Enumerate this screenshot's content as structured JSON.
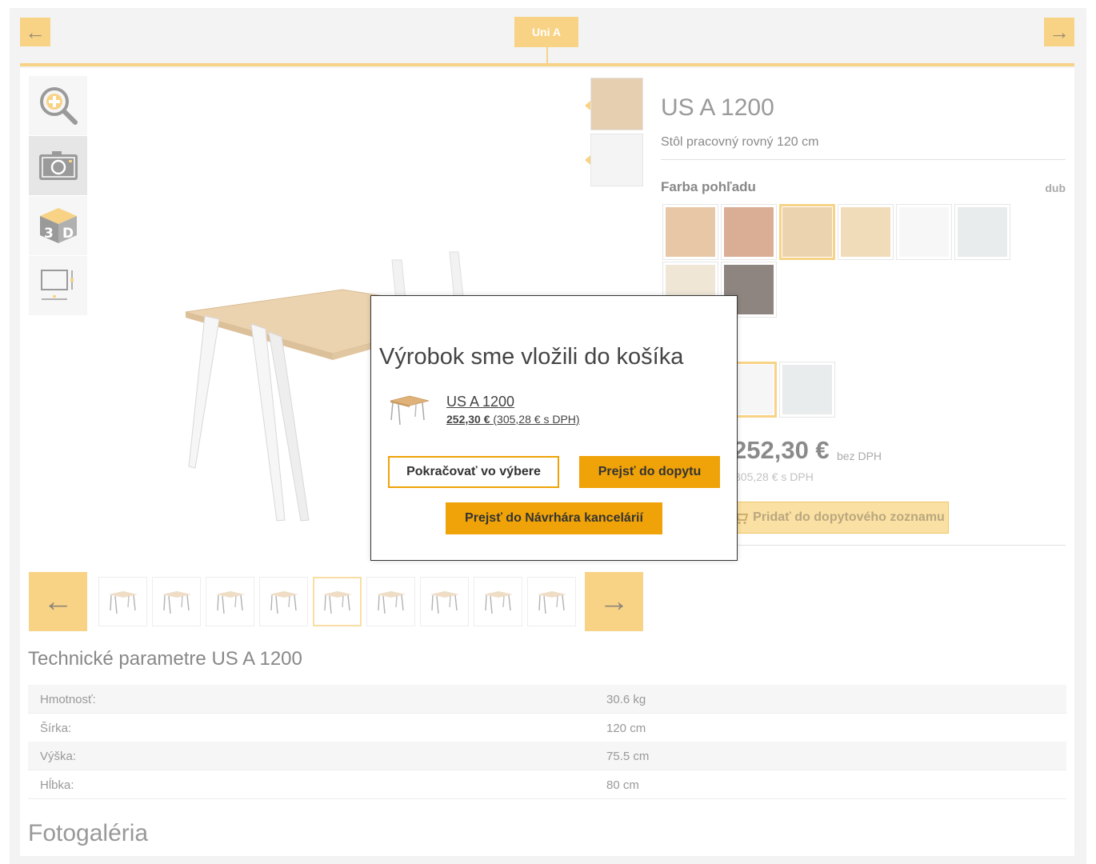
{
  "nav": {
    "prev_arrow": "←",
    "next_arrow": "→",
    "current_tab": "Uni A"
  },
  "toolbar": {
    "zoom_icon": "zoom-in-icon",
    "camera_icon": "camera-icon",
    "view3d_icon": "3d-view-icon",
    "dimensions_icon": "dimensions-icon",
    "view3d_letters": [
      "3",
      "D"
    ]
  },
  "gallery": {
    "prev_arrow": "←",
    "next_arrow": "→",
    "thumbnail_count": 9,
    "selected_thumbnail": 5
  },
  "product": {
    "title": "US A 1200",
    "subtitle": "Stôl pracovný rovný 120 cm",
    "color_label": "Farba pohľadu",
    "color_value": "dub",
    "swatches_top": [
      "#e8c7a6",
      "#d9ae95",
      "#ecd3b0",
      "#f1dcb9",
      "#f7f7f7",
      "#e9ecec"
    ],
    "swatches_row2": [
      "#efe6d6",
      "#8e8480"
    ],
    "swatches_row3": [
      "#f6f6f6",
      "#e9ecec"
    ],
    "price": "252,30 €",
    "price_note": "bez DPH",
    "price_vat": "305,28 € s DPH",
    "add_to_list": "Pridať do dopytového zoznamu"
  },
  "params": {
    "heading": "Technické parametre US A 1200",
    "rows": [
      {
        "key": "Hmotnosť:",
        "value": "30.6 kg"
      },
      {
        "key": "Šírka:",
        "value": "120 cm"
      },
      {
        "key": "Výška:",
        "value": "75.5 cm"
      },
      {
        "key": "Hĺbka:",
        "value": "80 cm"
      }
    ]
  },
  "photo_gallery_heading": "Fotogaléria",
  "modal": {
    "title": "Výrobok sme vložili do košíka",
    "product_name": "US A 1200",
    "price_bold": "252,30 €",
    "price_vat": "(305,28 € s DPH)",
    "continue_button": "Pokračovať vo výbere",
    "inquiry_button": "Prejsť do dopytu",
    "designer_button": "Prejsť do Návrhára kancelárií"
  },
  "colors": {
    "accent": "#f8d386",
    "accent_strong": "#f0a308",
    "wood": "#ecd3b0",
    "frame_white": "#ffffff"
  }
}
